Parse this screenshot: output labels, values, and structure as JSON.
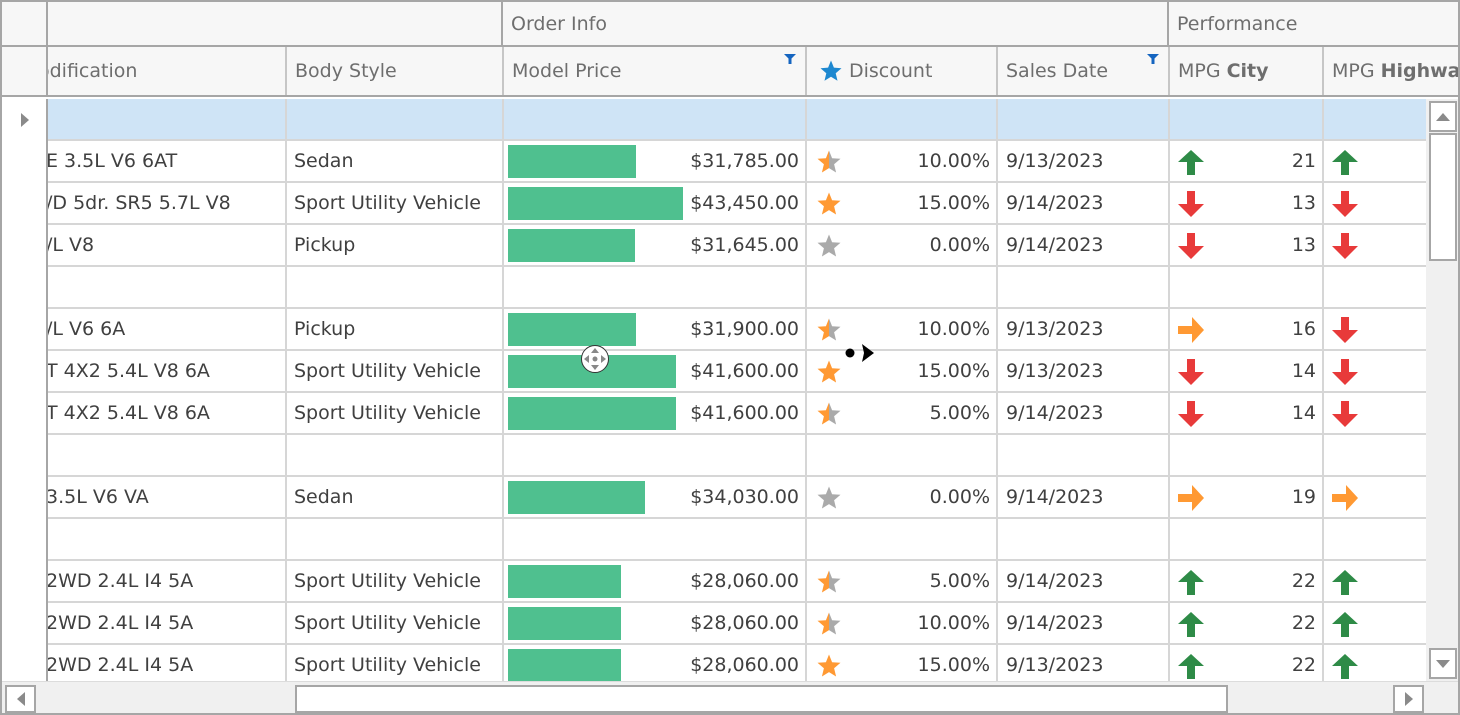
{
  "header": {
    "bands": [
      {
        "label": ""
      },
      {
        "label": "Order Info"
      },
      {
        "label": "Performance"
      }
    ],
    "columns": [
      {
        "key": "modification",
        "label": "odification",
        "filtered": false
      },
      {
        "key": "body_style",
        "label": "Body Style",
        "filtered": false
      },
      {
        "key": "model_price",
        "label": "Model Price",
        "filtered": true
      },
      {
        "key": "discount",
        "label": "Discount",
        "icon": "star-icon",
        "filtered": false
      },
      {
        "key": "sales_date",
        "label": "Sales Date",
        "filtered": true
      },
      {
        "key": "mpg_city",
        "label": "MPG",
        "label_bold": "City",
        "filtered": false
      },
      {
        "key": "mpg_highway",
        "label": "MPG",
        "label_bold": "Highwa",
        "filtered": false
      }
    ]
  },
  "colors": {
    "bar": "#4fc08f",
    "star_on": "#ff9933",
    "star_off": "#aaaaaa",
    "header_star": "#1e88d0",
    "filter": "#1565c0",
    "arrow_up": "#2e8b47",
    "arrow_down": "#e83a3a",
    "arrow_right": "#ff9933",
    "focused_row": "#cfe4f6"
  },
  "price_scale": {
    "min": 0,
    "max": 43450
  },
  "rows": [
    {
      "type": "group",
      "focused": true
    },
    {
      "type": "data",
      "modification": "E 3.5L V6 6AT",
      "body_style": "Sedan",
      "model_price": 31785,
      "model_price_text": "$31,785.00",
      "discount_fill": 0.5,
      "discount": "10.00%",
      "sales_date": "9/13/2023",
      "city_trend": "up",
      "mpg_city": "21",
      "hwy_trend": "up"
    },
    {
      "type": "data",
      "modification": "/D 5dr. SR5 5.7L V8",
      "body_style": "Sport Utility Vehicle",
      "model_price": 43450,
      "model_price_text": "$43,450.00",
      "discount_fill": 1,
      "discount": "15.00%",
      "sales_date": "9/14/2023",
      "city_trend": "down",
      "mpg_city": "13",
      "hwy_trend": "down"
    },
    {
      "type": "data",
      "modification": "/L V8",
      "body_style": "Pickup",
      "model_price": 31645,
      "model_price_text": "$31,645.00",
      "discount_fill": 0,
      "discount": "0.00%",
      "sales_date": "9/14/2023",
      "city_trend": "down",
      "mpg_city": "13",
      "hwy_trend": "down"
    },
    {
      "type": "group"
    },
    {
      "type": "data",
      "modification": "/L V6 6A",
      "body_style": "Pickup",
      "model_price": 31900,
      "model_price_text": "$31,900.00",
      "discount_fill": 0.5,
      "discount": "10.00%",
      "sales_date": "9/13/2023",
      "city_trend": "right",
      "mpg_city": "16",
      "hwy_trend": "down"
    },
    {
      "type": "data",
      "modification": "T 4X2 5.4L V8 6A",
      "body_style": "Sport Utility Vehicle",
      "model_price": 41600,
      "model_price_text": "$41,600.00",
      "discount_fill": 1,
      "discount": "15.00%",
      "sales_date": "9/13/2023",
      "city_trend": "down",
      "mpg_city": "14",
      "hwy_trend": "down"
    },
    {
      "type": "data",
      "modification": "T 4X2 5.4L V8 6A",
      "body_style": "Sport Utility Vehicle",
      "model_price": 41600,
      "model_price_text": "$41,600.00",
      "discount_fill": 0.5,
      "discount": "5.00%",
      "sales_date": "9/14/2023",
      "city_trend": "down",
      "mpg_city": "14",
      "hwy_trend": "down"
    },
    {
      "type": "group"
    },
    {
      "type": "data",
      "modification": " 3.5L V6 VA",
      "body_style": "Sedan",
      "model_price": 34030,
      "model_price_text": "$34,030.00",
      "discount_fill": 0,
      "discount": "0.00%",
      "sales_date": "9/14/2023",
      "city_trend": "right",
      "mpg_city": "19",
      "hwy_trend": "right"
    },
    {
      "type": "group"
    },
    {
      "type": "data",
      "modification": " 2WD 2.4L I4 5A",
      "body_style": "Sport Utility Vehicle",
      "model_price": 28060,
      "model_price_text": "$28,060.00",
      "discount_fill": 0.5,
      "discount": "5.00%",
      "sales_date": "9/14/2023",
      "city_trend": "up",
      "mpg_city": "22",
      "hwy_trend": "up"
    },
    {
      "type": "data",
      "modification": " 2WD 2.4L I4 5A",
      "body_style": "Sport Utility Vehicle",
      "model_price": 28060,
      "model_price_text": "$28,060.00",
      "discount_fill": 0.5,
      "discount": "10.00%",
      "sales_date": "9/14/2023",
      "city_trend": "up",
      "mpg_city": "22",
      "hwy_trend": "up"
    },
    {
      "type": "data",
      "modification": " 2WD 2.4L I4 5A",
      "body_style": "Sport Utility Vehicle",
      "model_price": 28060,
      "model_price_text": "$28,060.00",
      "discount_fill": 1,
      "discount": "15.00%",
      "sales_date": "9/13/2023",
      "city_trend": "up",
      "mpg_city": "22",
      "hwy_trend": "up"
    }
  ]
}
